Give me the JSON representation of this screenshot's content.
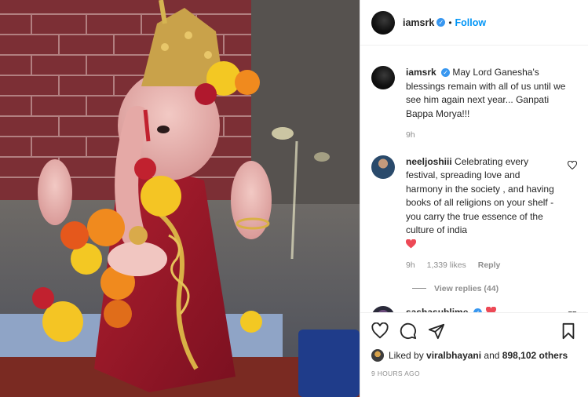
{
  "post": {
    "username": "iamsrk",
    "follow_label": "Follow",
    "dot": "•",
    "caption": "May Lord Ganesha's blessings remain with all of us until we see him again next year... Ganpati Bappa Morya!!!",
    "caption_time": "9h"
  },
  "comments": [
    {
      "username": "neeljoshiii",
      "text": "Celebrating every festival, spreading love and harmony in the society , and having books of all religions on your shelf - you carry the true essence of the culture of india",
      "time": "9h",
      "likes": "1,339 likes",
      "reply_label": "Reply",
      "view_replies": "View replies (44)"
    },
    {
      "username": "sashasublime"
    }
  ],
  "likes": {
    "username": "viralbhayani",
    "text_liked_by": "Liked by",
    "text_and": "and",
    "others": "898,102 others"
  },
  "posted_ago": "9 HOURS AGO",
  "icons": [
    "heart-icon",
    "comment-icon",
    "share-icon",
    "bookmark-icon",
    "verified-badge-icon",
    "red-heart-icon"
  ],
  "colors": {
    "link": "#0095f6",
    "verified": "#3897f0",
    "heart": "#ed4956",
    "muted": "#8e8e8e"
  }
}
